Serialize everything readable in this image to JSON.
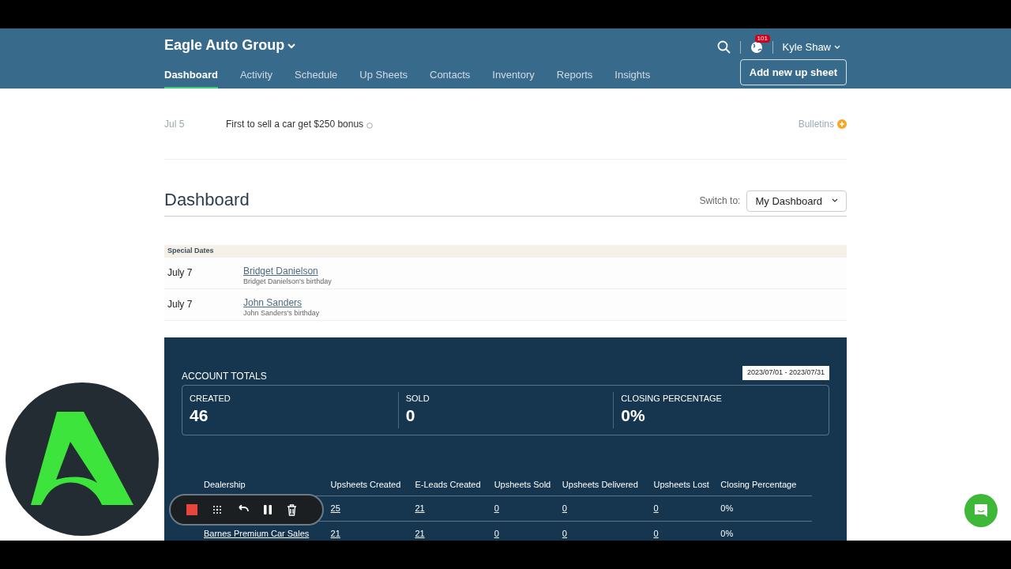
{
  "header": {
    "org": "Eagle Auto Group",
    "notifications_badge": "101",
    "user": "Kyle Shaw",
    "add_button": "Add new up sheet",
    "nav": [
      {
        "label": "Dashboard",
        "selected": true
      },
      {
        "label": "Activity",
        "selected": false
      },
      {
        "label": "Schedule",
        "selected": false
      },
      {
        "label": "Up Sheets",
        "selected": false
      },
      {
        "label": "Contacts",
        "selected": false
      },
      {
        "label": "Inventory",
        "selected": false
      },
      {
        "label": "Reports",
        "selected": false
      },
      {
        "label": "Insights",
        "selected": false
      }
    ]
  },
  "bulletin": {
    "date": "Jul 5",
    "text": "First to sell a car get $250 bonus",
    "link": "Bulletins"
  },
  "dashboard": {
    "title": "Dashboard",
    "switch_label": "Switch to:",
    "switch_value": "My Dashboard"
  },
  "special_dates": {
    "title": "Special Dates",
    "items": [
      {
        "date": "July 7",
        "name": "Bridget Danielson",
        "note": "Bridget Danielson's birthday"
      },
      {
        "date": "July 7",
        "name": "John Sanders",
        "note": "John Sanders's birthday"
      }
    ]
  },
  "account_totals": {
    "title": "ACCOUNT TOTALS",
    "date_range": "2023/07/01 - 2023/07/31",
    "stats": [
      {
        "label": "CREATED",
        "value": "46"
      },
      {
        "label": "SOLD",
        "value": "0"
      },
      {
        "label": "CLOSING PERCENTAGE",
        "value": "0%"
      }
    ]
  },
  "table": {
    "columns": [
      "Dealership",
      "Upsheets Created",
      "E-Leads Created",
      "Upsheets Sold",
      "Upsheets Delivered",
      "Upsheets Lost",
      "Closing Percentage"
    ],
    "rows": [
      {
        "cells": [
          "",
          "25",
          "21",
          "0",
          "0",
          "0",
          "0%"
        ]
      },
      {
        "cells": [
          "Barnes Premium Car Sales",
          "21",
          "21",
          "0",
          "0",
          "0",
          "0%"
        ]
      }
    ]
  }
}
